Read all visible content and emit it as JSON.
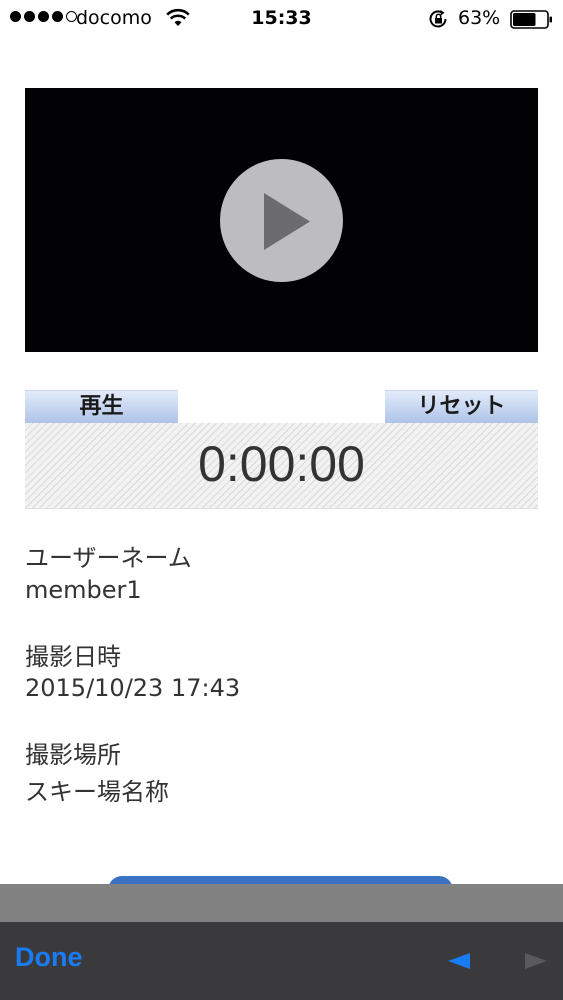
{
  "status_bar": {
    "carrier": "docomo",
    "time": "15:33",
    "battery_percent": "63%",
    "signal_bars_filled": 4,
    "signal_bars_total": 5
  },
  "video": {
    "play_icon": "play-icon"
  },
  "controls": {
    "play_label": "再生",
    "reset_label": "リセット",
    "timer": "0:00:00"
  },
  "fields": [
    {
      "label": "ユーザーネーム",
      "value": "member1"
    },
    {
      "label": "撮影日時",
      "value": "2015/10/23 17:43"
    },
    {
      "label": "撮影場所",
      "value": "スキー場名称"
    }
  ],
  "toolbar": {
    "done_label": "Done",
    "prev_icon": "previous-arrow-icon",
    "next_icon": "next-arrow-icon"
  },
  "colors": {
    "accent_blue": "#1a7cf5",
    "button_blue": "#aec3e8",
    "toolbar_bg": "#3a3a3c"
  }
}
